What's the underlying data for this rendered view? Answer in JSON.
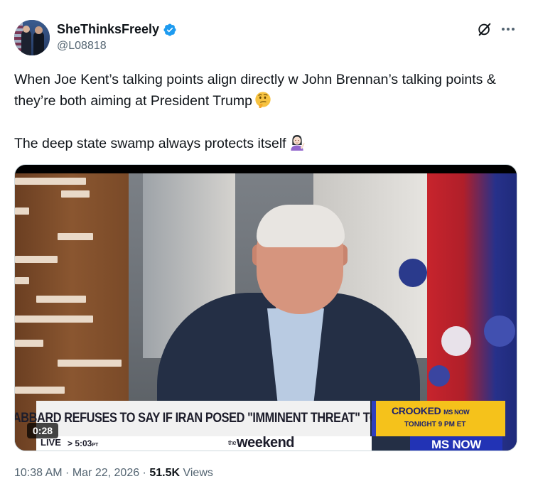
{
  "author": {
    "display_name": "SheThinksFreely",
    "handle": "@L08818",
    "verified": true,
    "verified_color": "#1d9bf0"
  },
  "tweet": {
    "text_para1": "When Joe Kent’s talking points align directly w John Brennan’s talking points & they’re both aiming at President Trump",
    "emoji1": "thinking-face",
    "text_para2": "The deep state swamp always protects itself",
    "emoji2": "woman-tipping-hand"
  },
  "video": {
    "duration": "0:28",
    "chyron": "GABBARD REFUSES TO SAY IF IRAN POSED \"IMMINENT THREAT\" TO U.S.",
    "promo_title": "CROOKED",
    "promo_network": "MS NOW",
    "promo_time": "TONIGHT 9 PM ET",
    "live_label": "LIVE",
    "time_label": "> 5:03",
    "time_zone": "PT",
    "show_prefix": "the",
    "show_name": "weekend",
    "network": "MS NOW"
  },
  "meta": {
    "time": "10:38 AM",
    "separator1": " · ",
    "date": "Mar 22, 2026",
    "separator2": " · ",
    "views": "51.5K",
    "views_label": " Views"
  },
  "colors": {
    "text_primary": "#0f1419",
    "text_secondary": "#536471",
    "accent": "#1d9bf0"
  }
}
